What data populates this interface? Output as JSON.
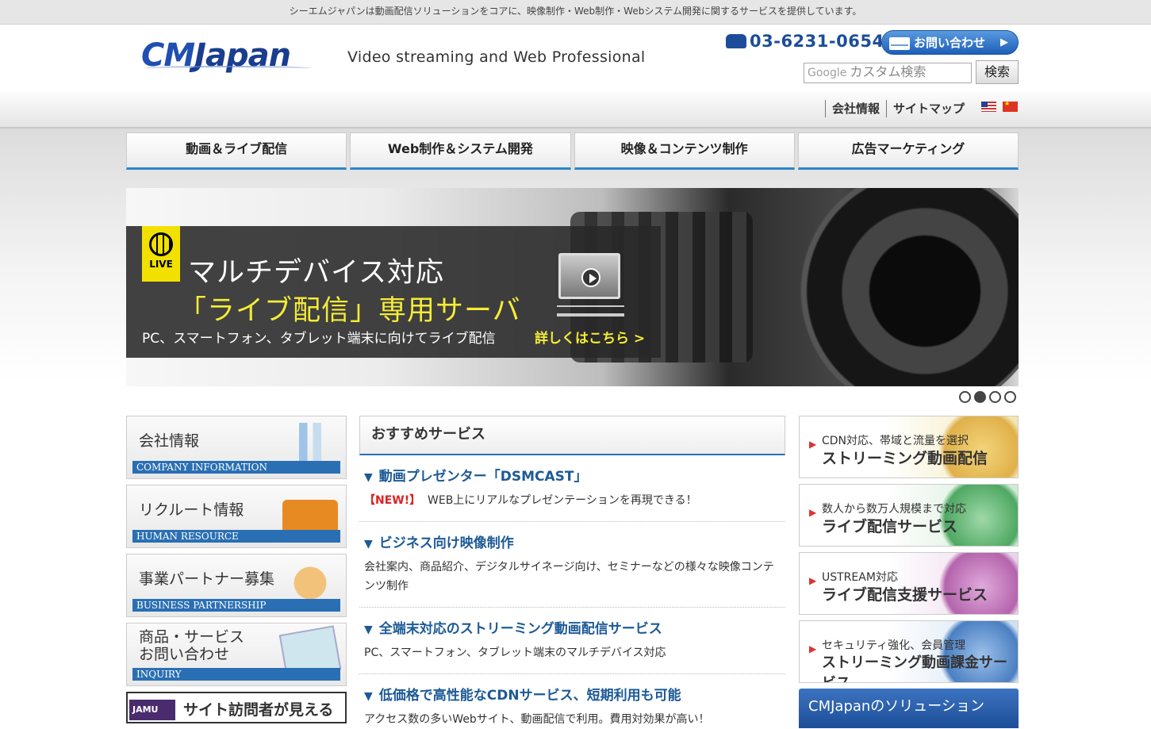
{
  "topbar": {
    "text": "シーエムジャパンは動画配信ソリューションをコアに、映像制作・Web制作・Webシステム開発に関するサービスを提供しています。"
  },
  "header": {
    "logo_cm": "CM",
    "logo_rest": "Japan",
    "tagline": "Video streaming and Web Professional",
    "phone": "03-6231-0654",
    "contact_label": "お問い合わせ",
    "contact_arrow": "▶",
    "search_google": "Google",
    "search_placeholder": "カスタム検索",
    "search_button": "検索"
  },
  "subnav": {
    "links": [
      "会社情報",
      "サイトマップ"
    ]
  },
  "mainnav": [
    "動画＆ライブ配信",
    "Web制作＆システム開発",
    "映像＆コンテンツ制作",
    "広告マーケティング"
  ],
  "banner": {
    "live": "LIVE",
    "line1": "マルチデバイス対応",
    "line2": "「ライブ配信」専用サーバ",
    "sub": "PC、スマートフォン、タブレット端末に向けてライブ配信",
    "more": "詳しくはこちら >",
    "active_slide": 2,
    "slide_count": 4
  },
  "left": [
    {
      "jp": "会社情報",
      "en": "COMPANY INFORMATION",
      "ill": "building-icon"
    },
    {
      "jp": "リクルート情報",
      "en": "HUMAN RESOURCE",
      "ill": "briefcase-icon"
    },
    {
      "jp": "事業パートナー募集",
      "en": "BUSINESS PARTNERSHIP",
      "ill": "handshake-icon"
    },
    {
      "jp": "商品・サービス\nお問い合わせ",
      "en": "INQUIRY",
      "ill": "envelope-icon"
    }
  ],
  "jamu": {
    "badge": "JAMU INC",
    "text": "サイト訪問者が見える"
  },
  "center": {
    "title": "おすすめサービス",
    "items": [
      {
        "title": "動画プレゼンター「DSMCAST」",
        "new": "【NEW!】",
        "desc": "WEB上にリアルなプレゼンテーションを再現できる！"
      },
      {
        "title": "ビジネス向け映像制作",
        "new": "",
        "desc": "会社案内、商品紹介、デジタルサイネージ向け、セミナーなどの様々な映像コンテンツ制作"
      },
      {
        "title": "全端末対応のストリーミング動画配信サービス",
        "new": "",
        "desc": "PC、スマートフォン、タブレット端末のマルチデバイス対応"
      },
      {
        "title": "低価格で高性能なCDNサービス、短期利用も可能",
        "new": "",
        "desc": "アクセス数の多いWebサイト、動画配信で利用。費用対効果が高い！"
      }
    ]
  },
  "right": [
    {
      "small": "CDN対応、帯域と流量を選択",
      "big": "ストリーミング動画配信"
    },
    {
      "small": "数人から数万人規模まで対応",
      "big": "ライブ配信サービス"
    },
    {
      "small": "USTREAM対応",
      "big": "ライブ配信支援サービス"
    },
    {
      "small": "セキュリティ強化、会員管理",
      "big": "ストリーミング動画課金サービス"
    }
  ],
  "solution": "CMJapanのソリューション"
}
